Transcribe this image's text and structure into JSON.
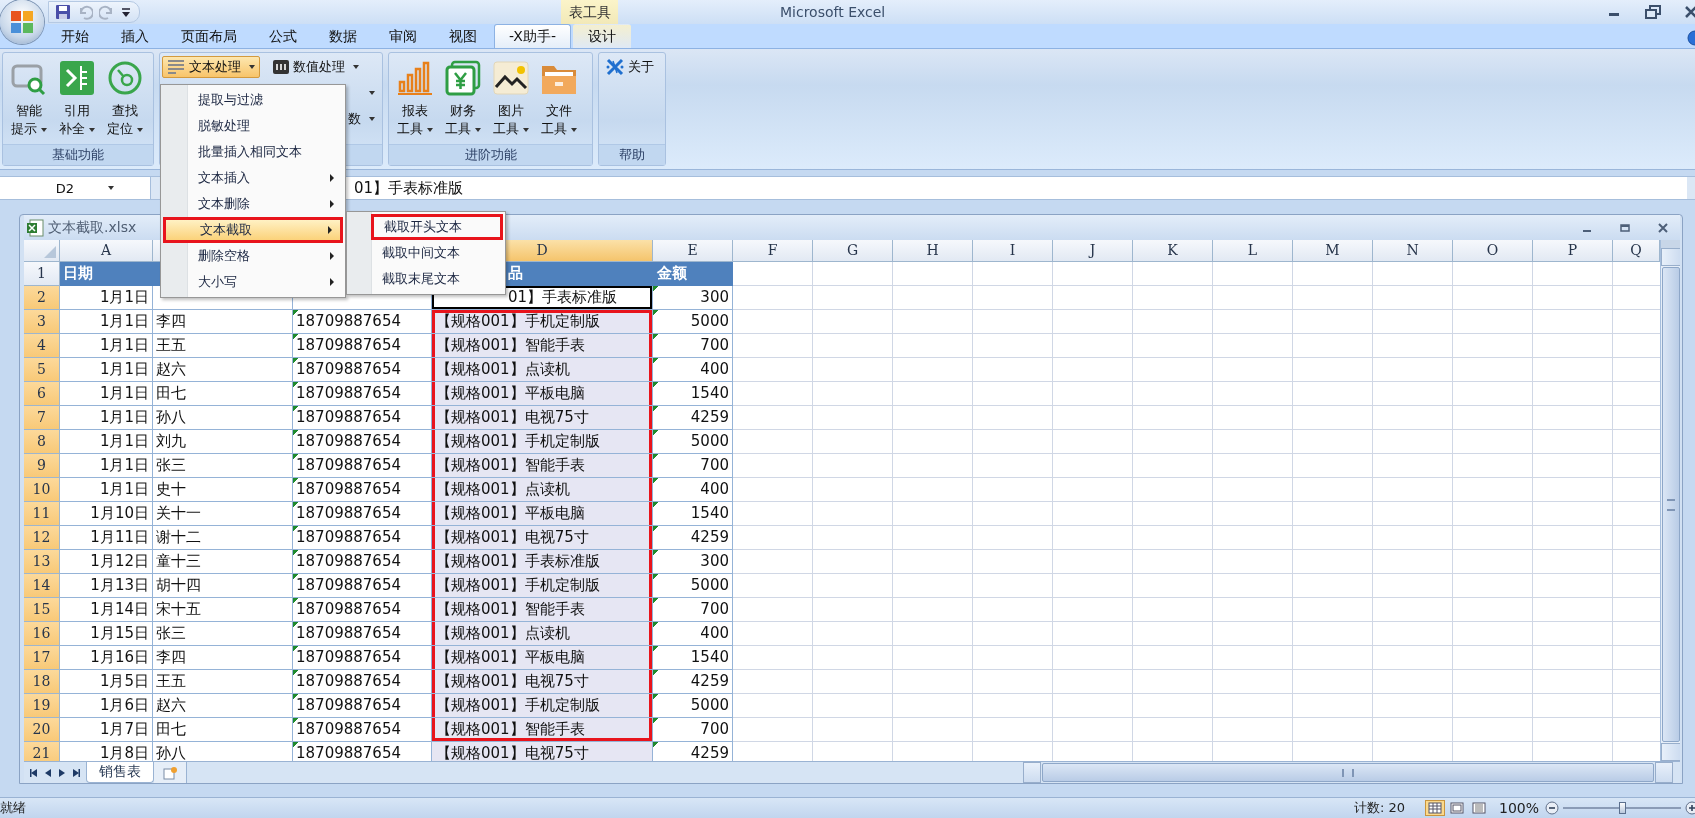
{
  "app": {
    "title": "Microsoft Excel",
    "contextual_group": "表工具"
  },
  "quick_access": [
    {
      "kind": "save",
      "disabled": false
    },
    {
      "kind": "undo",
      "disabled": true
    },
    {
      "kind": "redo",
      "disabled": true
    },
    {
      "kind": "customize",
      "disabled": false
    }
  ],
  "tabs": [
    {
      "label": "开始",
      "selected": false,
      "contextual": false
    },
    {
      "label": "插入",
      "selected": false,
      "contextual": false
    },
    {
      "label": "页面布局",
      "selected": false,
      "contextual": false
    },
    {
      "label": "公式",
      "selected": false,
      "contextual": false
    },
    {
      "label": "数据",
      "selected": false,
      "contextual": false
    },
    {
      "label": "审阅",
      "selected": false,
      "contextual": false
    },
    {
      "label": "视图",
      "selected": false,
      "contextual": false
    },
    {
      "label": "-X助手-",
      "selected": true,
      "contextual": false
    },
    {
      "label": "设计",
      "selected": false,
      "contextual": true
    }
  ],
  "ribbon": {
    "groups": [
      {
        "label": "基础功能",
        "columns": [
          [
            {
              "kind": "large",
              "lines": [
                "智能",
                "提示"
              ],
              "dropdown": true,
              "pressed": false
            }
          ],
          [
            {
              "kind": "large",
              "lines": [
                "引用",
                "补全"
              ],
              "dropdown": true,
              "pressed": false
            }
          ],
          [
            {
              "kind": "large",
              "lines": [
                "查找",
                "定位"
              ],
              "dropdown": true,
              "pressed": false
            }
          ]
        ]
      },
      {
        "columns": [
          [
            {
              "kind": "small",
              "label": "文本处理",
              "dropdown": true,
              "pressed": true
            }
          ],
          [
            {
              "kind": "small",
              "label": "数值处理",
              "dropdown": true,
              "pressed": false
            },
            {
              "kind": "caret",
              "dropdown": true,
              "pressed": false
            },
            {
              "kind": "small",
              "label": "数",
              "dropdown": true,
              "pressed": false
            }
          ]
        ]
      },
      {
        "label": "进阶功能",
        "columns": [
          [
            {
              "kind": "large",
              "lines": [
                "报表",
                "工具"
              ],
              "dropdown": true,
              "pressed": false
            }
          ],
          [
            {
              "kind": "large",
              "lines": [
                "财务",
                "工具"
              ],
              "dropdown": true,
              "pressed": false
            }
          ],
          [
            {
              "kind": "large",
              "lines": [
                "图片",
                "工具"
              ],
              "dropdown": true,
              "pressed": false
            }
          ],
          [
            {
              "kind": "large",
              "lines": [
                "文件",
                "工具"
              ],
              "dropdown": true,
              "pressed": false
            }
          ]
        ]
      },
      {
        "label": "帮助",
        "columns": [
          [
            {
              "kind": "small",
              "label": "关于",
              "dropdown": false,
              "pressed": false
            }
          ]
        ]
      }
    ]
  },
  "menu": {
    "items": [
      {
        "label": "提取与过滤",
        "has_submenu": false,
        "selected": false,
        "annotated": false
      },
      {
        "label": "脱敏处理",
        "has_submenu": false,
        "selected": false,
        "annotated": false
      },
      {
        "label": "批量插入相同文本",
        "has_submenu": false,
        "selected": false,
        "annotated": false
      },
      {
        "label": "文本插入",
        "has_submenu": true,
        "selected": false,
        "annotated": false
      },
      {
        "label": "文本删除",
        "has_submenu": true,
        "selected": false,
        "annotated": false
      },
      {
        "label": "文本截取",
        "has_submenu": true,
        "selected": true,
        "annotated": true,
        "children": [
          {
            "label": "截取开头文本",
            "selected": false,
            "annotated": true
          },
          {
            "label": "截取中间文本",
            "selected": false,
            "annotated": false
          },
          {
            "label": "截取末尾文本",
            "selected": false,
            "annotated": false
          }
        ]
      },
      {
        "label": "删除空格",
        "has_submenu": true,
        "selected": false,
        "annotated": false
      },
      {
        "label": "大小写",
        "has_submenu": true,
        "selected": false,
        "annotated": false
      }
    ]
  },
  "formula_bar": {
    "name_box": "D2",
    "formula": "01】手表标准版"
  },
  "workbook": {
    "title": "文本截取.xlsx"
  },
  "columns": [
    {
      "label": "A",
      "selected": false
    },
    {
      "selected": false
    },
    {},
    {
      "label": "D",
      "selected": true
    },
    {
      "label": "E",
      "selected": false
    },
    {
      "label": "F",
      "selected": false
    },
    {
      "label": "G",
      "selected": false
    },
    {
      "label": "H",
      "selected": false
    },
    {
      "label": "I",
      "selected": false
    },
    {
      "label": "J",
      "selected": false
    },
    {
      "label": "K",
      "selected": false
    },
    {
      "label": "L",
      "selected": false
    },
    {
      "label": "M",
      "selected": false
    },
    {
      "label": "N",
      "selected": false
    },
    {
      "label": "O",
      "selected": false
    },
    {
      "label": "P",
      "selected": false
    },
    {
      "label": "Q",
      "selected": false
    }
  ],
  "rows": [
    {
      "number": "1",
      "selected": false,
      "kind": "header",
      "range_selected": false,
      "active": false,
      "boxed": false,
      "cells": {
        "a": "日期",
        "d": "品",
        "e": "金额"
      }
    },
    {
      "number": "2",
      "selected": true,
      "kind": "data",
      "range_selected": true,
      "active": true,
      "boxed": false,
      "cells": {
        "a": "1月1日",
        "d": "01】手表标准版",
        "e": "300"
      }
    },
    {
      "number": "3",
      "selected": true,
      "kind": "data",
      "range_selected": true,
      "active": false,
      "boxed": true,
      "cells": {
        "a": "1月1日",
        "b": "李四",
        "c": "18709887654",
        "d": "【规格001】手机定制版",
        "e": "5000"
      }
    },
    {
      "number": "4",
      "selected": true,
      "kind": "data",
      "range_selected": true,
      "active": false,
      "boxed": true,
      "cells": {
        "a": "1月1日",
        "b": "王五",
        "c": "18709887654",
        "d": "【规格001】智能手表",
        "e": "700"
      }
    },
    {
      "number": "5",
      "selected": true,
      "kind": "data",
      "range_selected": true,
      "active": false,
      "boxed": true,
      "cells": {
        "a": "1月1日",
        "b": "赵六",
        "c": "18709887654",
        "d": "【规格001】点读机",
        "e": "400"
      }
    },
    {
      "number": "6",
      "selected": true,
      "kind": "data",
      "range_selected": true,
      "active": false,
      "boxed": true,
      "cells": {
        "a": "1月1日",
        "b": "田七",
        "c": "18709887654",
        "d": "【规格001】平板电脑",
        "e": "1540"
      }
    },
    {
      "number": "7",
      "selected": true,
      "kind": "data",
      "range_selected": true,
      "active": false,
      "boxed": true,
      "cells": {
        "a": "1月1日",
        "b": "孙八",
        "c": "18709887654",
        "d": "【规格001】电视75寸",
        "e": "4259"
      }
    },
    {
      "number": "8",
      "selected": true,
      "kind": "data",
      "range_selected": true,
      "active": false,
      "boxed": true,
      "cells": {
        "a": "1月1日",
        "b": "刘九",
        "c": "18709887654",
        "d": "【规格001】手机定制版",
        "e": "5000"
      }
    },
    {
      "number": "9",
      "selected": true,
      "kind": "data",
      "range_selected": true,
      "active": false,
      "boxed": true,
      "cells": {
        "a": "1月1日",
        "b": "张三",
        "c": "18709887654",
        "d": "【规格001】智能手表",
        "e": "700"
      }
    },
    {
      "number": "10",
      "selected": true,
      "kind": "data",
      "range_selected": true,
      "active": false,
      "boxed": true,
      "cells": {
        "a": "1月1日",
        "b": "史十",
        "c": "18709887654",
        "d": "【规格001】点读机",
        "e": "400"
      }
    },
    {
      "number": "11",
      "selected": true,
      "kind": "data",
      "range_selected": true,
      "active": false,
      "boxed": true,
      "cells": {
        "a": "1月10日",
        "b": "关十一",
        "c": "18709887654",
        "d": "【规格001】平板电脑",
        "e": "1540"
      }
    },
    {
      "number": "12",
      "selected": true,
      "kind": "data",
      "range_selected": true,
      "active": false,
      "boxed": true,
      "cells": {
        "a": "1月11日",
        "b": "谢十二",
        "c": "18709887654",
        "d": "【规格001】电视75寸",
        "e": "4259"
      }
    },
    {
      "number": "13",
      "selected": true,
      "kind": "data",
      "range_selected": true,
      "active": false,
      "boxed": true,
      "cells": {
        "a": "1月12日",
        "b": "童十三",
        "c": "18709887654",
        "d": "【规格001】手表标准版",
        "e": "300"
      }
    },
    {
      "number": "14",
      "selected": true,
      "kind": "data",
      "range_selected": true,
      "active": false,
      "boxed": true,
      "cells": {
        "a": "1月13日",
        "b": "胡十四",
        "c": "18709887654",
        "d": "【规格001】手机定制版",
        "e": "5000"
      }
    },
    {
      "number": "15",
      "selected": true,
      "kind": "data",
      "range_selected": true,
      "active": false,
      "boxed": true,
      "cells": {
        "a": "1月14日",
        "b": "宋十五",
        "c": "18709887654",
        "d": "【规格001】智能手表",
        "e": "700"
      }
    },
    {
      "number": "16",
      "selected": true,
      "kind": "data",
      "range_selected": true,
      "active": false,
      "boxed": true,
      "cells": {
        "a": "1月15日",
        "b": "张三",
        "c": "18709887654",
        "d": "【规格001】点读机",
        "e": "400"
      }
    },
    {
      "number": "17",
      "selected": true,
      "kind": "data",
      "range_selected": true,
      "active": false,
      "boxed": true,
      "cells": {
        "a": "1月16日",
        "b": "李四",
        "c": "18709887654",
        "d": "【规格001】平板电脑",
        "e": "1540"
      }
    },
    {
      "number": "18",
      "selected": true,
      "kind": "data",
      "range_selected": true,
      "active": false,
      "boxed": true,
      "cells": {
        "a": "1月5日",
        "b": "王五",
        "c": "18709887654",
        "d": "【规格001】电视75寸",
        "e": "4259"
      }
    },
    {
      "number": "19",
      "selected": true,
      "kind": "data",
      "range_selected": true,
      "active": false,
      "boxed": true,
      "cells": {
        "a": "1月6日",
        "b": "赵六",
        "c": "18709887654",
        "d": "【规格001】手机定制版",
        "e": "5000"
      }
    },
    {
      "number": "20",
      "selected": true,
      "kind": "data",
      "range_selected": true,
      "active": false,
      "boxed": true,
      "cells": {
        "a": "1月7日",
        "b": "田七",
        "c": "18709887654",
        "d": "【规格001】智能手表",
        "e": "700"
      }
    },
    {
      "number": "21",
      "selected": true,
      "kind": "data",
      "range_selected": true,
      "active": false,
      "boxed": false,
      "cells": {
        "a": "1月8日",
        "b": "孙八",
        "c": "18709887654",
        "d": "【规格001】电视75寸",
        "e": "4259"
      }
    }
  ],
  "sheet_tabs": [
    {
      "label": "销售表",
      "selected": true
    }
  ],
  "status_bar": {
    "mode": "就绪",
    "count": "计数: 20",
    "views": [
      {
        "kind": "normal",
        "selected": true
      },
      {
        "kind": "page_layout",
        "selected": false
      },
      {
        "kind": "page_break",
        "selected": false
      }
    ],
    "zoom": "100%",
    "zoom_slider": {
      "level": 0.5
    }
  }
}
